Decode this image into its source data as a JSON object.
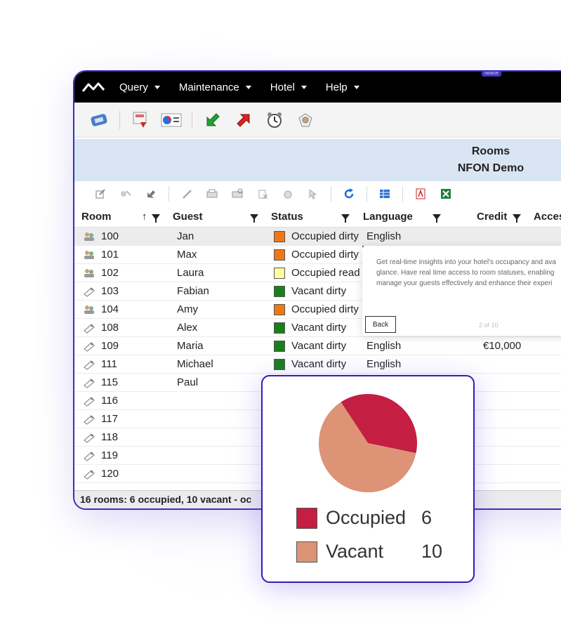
{
  "menubar": {
    "items": [
      {
        "label": "Query"
      },
      {
        "label": "Maintenance"
      },
      {
        "label": "Hotel"
      },
      {
        "label": "Help"
      }
    ],
    "badge": "Notice"
  },
  "titlebox": {
    "title": "Rooms",
    "subtitle": "NFON Demo"
  },
  "grid": {
    "columns": [
      "Room",
      "Guest",
      "Status",
      "Language",
      "Credit",
      "Acces"
    ],
    "rows": [
      {
        "room": "100",
        "guest": "Jan",
        "status": "Occupied dirty",
        "status_color": "#f07814",
        "language": "English",
        "credit": "",
        "occupied": true
      },
      {
        "room": "101",
        "guest": "Max",
        "status": "Occupied dirty",
        "status_color": "#f07814",
        "language": "",
        "credit": "",
        "occupied": true
      },
      {
        "room": "102",
        "guest": "Laura",
        "status": "Occupied read",
        "status_color": "#ffffa0",
        "language": "",
        "credit": "",
        "occupied": true
      },
      {
        "room": "103",
        "guest": "Fabian",
        "status": "Vacant dirty",
        "status_color": "#1a7f1a",
        "language": "",
        "credit": "",
        "occupied": false
      },
      {
        "room": "104",
        "guest": "Amy",
        "status": "Occupied dirty",
        "status_color": "#f07814",
        "language": "",
        "credit": "",
        "occupied": true
      },
      {
        "room": "108",
        "guest": "Alex",
        "status": "Vacant dirty",
        "status_color": "#1a7f1a",
        "language": "",
        "credit": "",
        "occupied": false
      },
      {
        "room": "109",
        "guest": "Maria",
        "status": "Vacant dirty",
        "status_color": "#1a7f1a",
        "language": "English",
        "credit": "€10,000",
        "occupied": false
      },
      {
        "room": "111",
        "guest": "Michael",
        "status": "Vacant dirty",
        "status_color": "#1a7f1a",
        "language": "English",
        "credit": "",
        "occupied": false
      },
      {
        "room": "115",
        "guest": "Paul",
        "status": "",
        "status_color": "",
        "language": "",
        "credit": "",
        "occupied": false
      },
      {
        "room": "116",
        "guest": "",
        "status": "",
        "status_color": "",
        "language": "",
        "credit": "",
        "occupied": false
      },
      {
        "room": "117",
        "guest": "",
        "status": "",
        "status_color": "",
        "language": "",
        "credit": "",
        "occupied": false
      },
      {
        "room": "118",
        "guest": "",
        "status": "",
        "status_color": "",
        "language": "",
        "credit": "",
        "occupied": false
      },
      {
        "room": "119",
        "guest": "",
        "status": "",
        "status_color": "",
        "language": "",
        "credit": "",
        "occupied": false
      },
      {
        "room": "120",
        "guest": "",
        "status": "",
        "status_color": "",
        "language": "",
        "credit": "",
        "occupied": false
      }
    ]
  },
  "statusbar": {
    "text": "16 rooms: 6 occupied, 10 vacant - oc"
  },
  "tooltip": {
    "text": "Get real-time insights into your hotel's occupancy and ava glance. Have real time access to room statuses, enabling manage your guests effectively and enhance their experi",
    "back_label": "Back",
    "page_label": "2 of 10"
  },
  "chart_data": {
    "type": "pie",
    "categories": [
      "Occupied",
      "Vacant"
    ],
    "values": [
      6,
      10
    ],
    "colors": [
      "#c41e42",
      "#dc9376"
    ]
  },
  "icons": {
    "toolbar1": [
      "phone-icon",
      "report-icon",
      "chart-icon",
      "check-in-icon",
      "check-out-icon",
      "alarm-clock-icon",
      "settings-icon"
    ],
    "toolbar2": [
      "export-icon",
      "import-icon",
      "forward-icon",
      "edit-icon",
      "print-icon",
      "print-preview-icon",
      "delete-icon",
      "hand-icon",
      "pointer-icon",
      "refresh-icon",
      "table-icon",
      "pdf-icon",
      "excel-icon"
    ]
  }
}
